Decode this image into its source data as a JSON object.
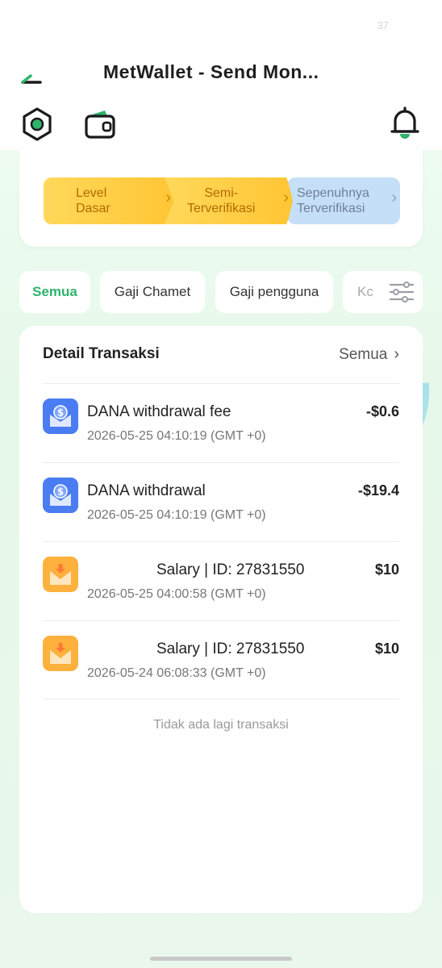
{
  "status": {
    "number": "37"
  },
  "header": {
    "title": "MetWallet - Send Mon..."
  },
  "levels": [
    {
      "line1": "Level",
      "line2": "Dasar"
    },
    {
      "line1": "Semi-",
      "line2": "Terverifikasi"
    },
    {
      "line1": "Sepenuhnya",
      "line2": "Terverifikasi"
    }
  ],
  "tabs": [
    {
      "label": "Semua"
    },
    {
      "label": "Gaji Chamet"
    },
    {
      "label": "Gaji pengguna"
    },
    {
      "label": "Kc"
    }
  ],
  "transactions": {
    "title": "Detail Transaksi",
    "all_label": "Semua",
    "items": [
      {
        "icon": "dollar-envelope-icon",
        "name": "DANA withdrawal fee",
        "time": "2026-05-25 04:10:19 (GMT +0)",
        "amount": "-$0.6"
      },
      {
        "icon": "dollar-envelope-icon",
        "name": "DANA withdrawal",
        "time": "2026-05-25 04:10:19 (GMT +0)",
        "amount": "-$19.4"
      },
      {
        "icon": "salary-envelope-icon",
        "name": "Salary | ID: 27831550",
        "time": "2026-05-25 04:00:58 (GMT +0)",
        "amount": "$10"
      },
      {
        "icon": "salary-envelope-icon",
        "name": "Salary | ID: 27831550",
        "time": "2026-05-24 06:08:33 (GMT +0)",
        "amount": "$10"
      }
    ],
    "empty_text": "Tidak ada lagi transaksi"
  },
  "colors": {
    "accent_green": "#2fb36b",
    "level_gold": "#ffc533",
    "level_blue": "#c6dff8",
    "icon_blue": "#4a7cf2",
    "icon_orange": "#ffb13d"
  }
}
